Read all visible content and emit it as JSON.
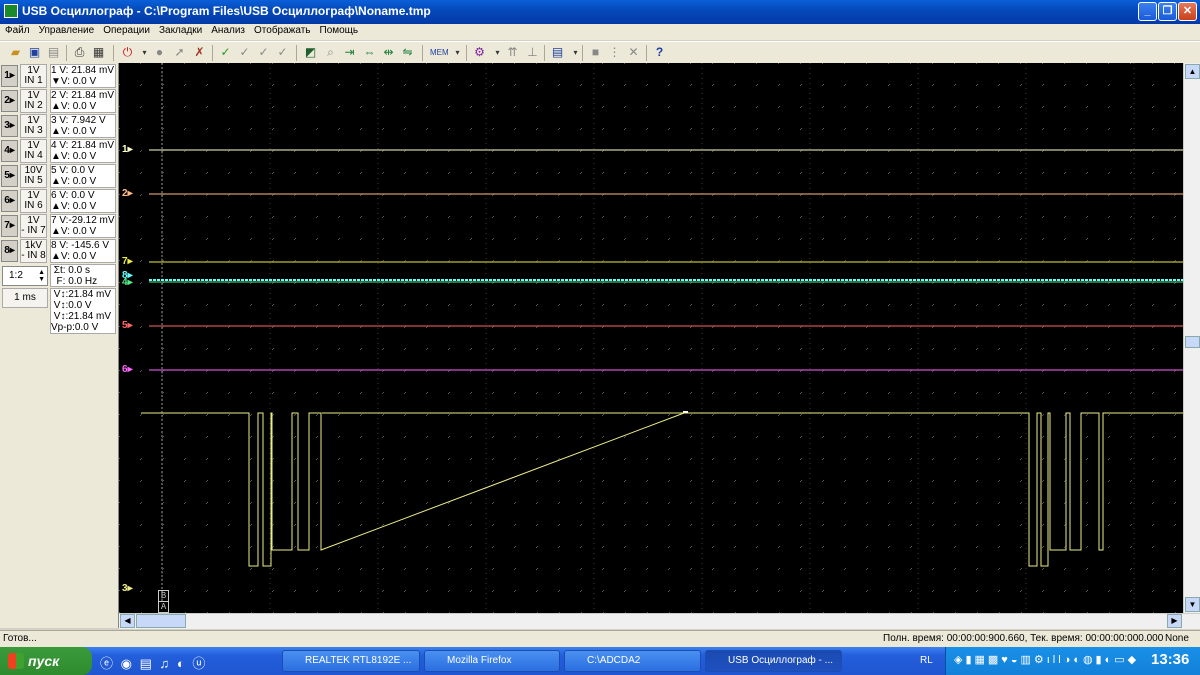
{
  "window": {
    "title": "USB Осциллограф - C:\\Program Files\\USB Осциллограф\\Noname.tmp"
  },
  "menu": [
    "Файл",
    "Управление",
    "Операции",
    "Закладки",
    "Анализ",
    "Отображать",
    "Помощь"
  ],
  "channels": [
    {
      "num": "1",
      "btn": "1▸",
      "scale": "1V",
      "input": "IN 1",
      "v": "21.84 mV",
      "dv": "0.0 V",
      "color": "#ffffcc"
    },
    {
      "num": "2",
      "btn": "2▸",
      "scale": "1V",
      "input": "IN 2",
      "v": "21.84 mV",
      "dv": "0.0 V",
      "color": "#ffcc99"
    },
    {
      "num": "3",
      "btn": "3▸",
      "scale": "1V",
      "input": "IN 3",
      "v": "7.942 V",
      "dv": "0.0 V",
      "color": "#ffff66"
    },
    {
      "num": "4",
      "btn": "4▸",
      "scale": "1V",
      "input": "IN 4",
      "v": "21.84 mV",
      "dv": "0.0 V",
      "color": "#66ff99"
    },
    {
      "num": "5",
      "btn": "5▸",
      "scale": "10V",
      "input": "IN 5",
      "v": "0.0 V",
      "dv": "0.0 V",
      "color": "#ff6666"
    },
    {
      "num": "6",
      "btn": "6▸",
      "scale": "1V",
      "input": "IN 6",
      "v": "0.0 V",
      "dv": "0.0 V",
      "color": "#ff66ff"
    },
    {
      "num": "7",
      "btn": "7▸",
      "scale": "1V",
      "input": "- IN 7",
      "v": "-29.12 mV",
      "dv": "0.0 V",
      "color": "#ffff66"
    },
    {
      "num": "8",
      "btn": "8▸",
      "scale": "1kV",
      "input": "- IN 8",
      "v": "-145.6 V",
      "dv": "0.0 V",
      "color": "#66ffff"
    }
  ],
  "measure": {
    "t": "0.0 s",
    "f": "0.0 Hz",
    "v1": "21.84 mV",
    "v2": "0.0 V",
    "v3": "21.84 mV",
    "vpp": "0.0 V"
  },
  "zoom": "1:2",
  "timebase": "1 ms",
  "cursors": {
    "b": "B",
    "a": "A"
  },
  "status": {
    "left": "Готов...",
    "right": "Полн. время: 00:00:00:900.660, Тек. время: 00:00:00:000.000",
    "mode": "None"
  },
  "taskbar": {
    "start": "пуск",
    "tasks": [
      "REALTEK RTL8192E ...",
      "Mozilla Firefox",
      "C:\\ADCDA2",
      "USB Осциллограф - ..."
    ],
    "lang": "RL",
    "clock": "13:36"
  }
}
